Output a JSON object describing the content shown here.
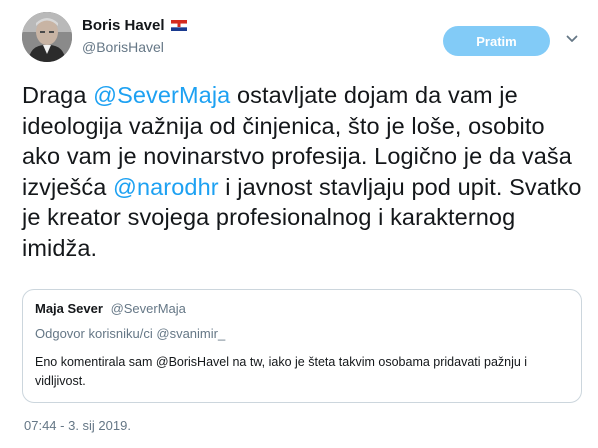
{
  "author": {
    "display_name": "Boris Havel",
    "handle": "@BorisHavel",
    "flag": "croatia-flag"
  },
  "follow_button": {
    "label": "Pratim"
  },
  "tweet": {
    "text_1": "Draga ",
    "mention_1": "@SeverMaja",
    "text_2": " ostavljate dojam da vam je ideologija važnija od činjenica, što je loše, osobito ako vam je novinarstvo profesija. Logično je da vaša izvješća ",
    "mention_2": "@narodhr",
    "text_3": " i javnost stavljaju pod upit. Svatko je kreator svojega profesionalnog i karakternog imidža."
  },
  "quoted_tweet": {
    "display_name": "Maja Sever",
    "handle": "@SeverMaja",
    "reply_to": "Odgovor korisniku/ci @svanimir_",
    "text": "Eno komentirala sam @BorisHavel na tw, iako je šteta takvim osobama pridavati pažnju i vidljivost."
  },
  "timestamp": "07:44 - 3. sij 2019.",
  "colors": {
    "accent": "#1da1f2",
    "secondary_text": "#657786",
    "border": "#ccd6dd"
  }
}
